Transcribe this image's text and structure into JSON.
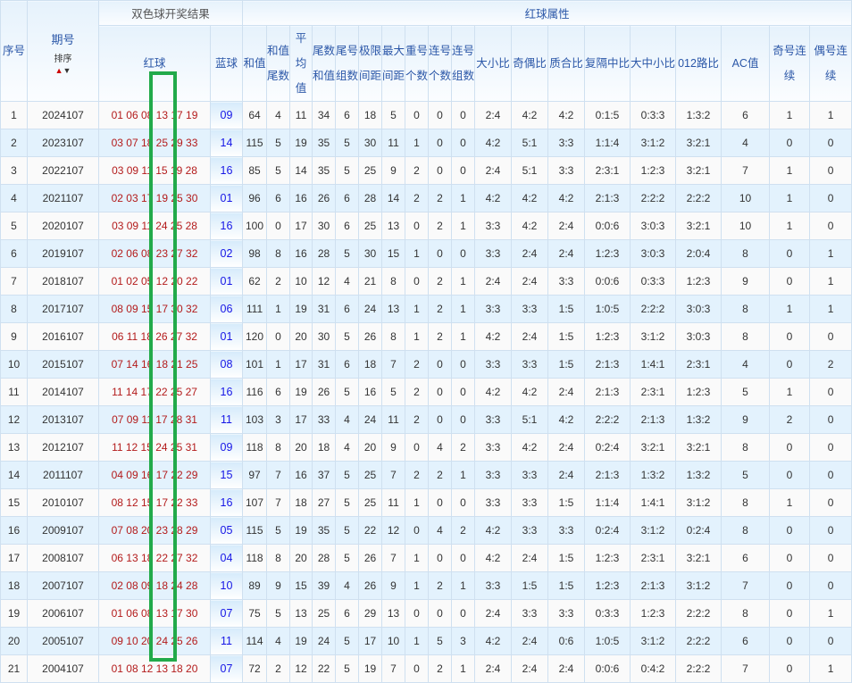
{
  "header": {
    "seq": "序号",
    "issue": "期号",
    "sort_label": "排序",
    "draw_result": "双色球开奖结果",
    "red_ball": "红球",
    "blue_ball": "蓝球",
    "red_attrs": "红球属性",
    "columns": [
      "和值",
      "和值尾数",
      "平均值",
      "尾数和值",
      "尾号组数",
      "极限间距",
      "最大间距",
      "重号个数",
      "连号个数",
      "连号组数",
      "大小比",
      "奇偶比",
      "质合比",
      "复隔中比",
      "大中小比",
      "012路比",
      "AC值",
      "奇号连续",
      "偶号连续"
    ]
  },
  "colors": {
    "red_ball": "#b31b1b",
    "blue_ball": "#1616e6",
    "highlight_box": "#22aa4a",
    "header_text": "#2b57a8"
  },
  "icons": {
    "sort_up": "arrow-up-icon",
    "sort_down": "arrow-down-icon"
  },
  "rows": [
    [
      "1",
      "2024107",
      "01 06 08 13 17 19",
      "09",
      "64",
      "4",
      "11",
      "34",
      "6",
      "18",
      "5",
      "0",
      "0",
      "0",
      "2:4",
      "4:2",
      "4:2",
      "0:1:5",
      "0:3:3",
      "1:3:2",
      "6",
      "1",
      "1"
    ],
    [
      "2",
      "2023107",
      "03 07 18 25 29 33",
      "14",
      "115",
      "5",
      "19",
      "35",
      "5",
      "30",
      "11",
      "1",
      "0",
      "0",
      "4:2",
      "5:1",
      "3:3",
      "1:1:4",
      "3:1:2",
      "3:2:1",
      "4",
      "0",
      "0"
    ],
    [
      "3",
      "2022107",
      "03 09 11 15 19 28",
      "16",
      "85",
      "5",
      "14",
      "35",
      "5",
      "25",
      "9",
      "2",
      "0",
      "0",
      "2:4",
      "5:1",
      "3:3",
      "2:3:1",
      "1:2:3",
      "3:2:1",
      "7",
      "1",
      "0"
    ],
    [
      "4",
      "2021107",
      "02 03 17 19 25 30",
      "01",
      "96",
      "6",
      "16",
      "26",
      "6",
      "28",
      "14",
      "2",
      "2",
      "1",
      "4:2",
      "4:2",
      "4:2",
      "2:1:3",
      "2:2:2",
      "2:2:2",
      "10",
      "1",
      "0"
    ],
    [
      "5",
      "2020107",
      "03 09 11 24 25 28",
      "16",
      "100",
      "0",
      "17",
      "30",
      "6",
      "25",
      "13",
      "0",
      "2",
      "1",
      "3:3",
      "4:2",
      "2:4",
      "0:0:6",
      "3:0:3",
      "3:2:1",
      "10",
      "1",
      "0"
    ],
    [
      "6",
      "2019107",
      "02 06 08 23 27 32",
      "02",
      "98",
      "8",
      "16",
      "28",
      "5",
      "30",
      "15",
      "1",
      "0",
      "0",
      "3:3",
      "2:4",
      "2:4",
      "1:2:3",
      "3:0:3",
      "2:0:4",
      "8",
      "0",
      "1"
    ],
    [
      "7",
      "2018107",
      "01 02 05 12 20 22",
      "01",
      "62",
      "2",
      "10",
      "12",
      "4",
      "21",
      "8",
      "0",
      "2",
      "1",
      "2:4",
      "2:4",
      "3:3",
      "0:0:6",
      "0:3:3",
      "1:2:3",
      "9",
      "0",
      "1"
    ],
    [
      "8",
      "2017107",
      "08 09 15 17 30 32",
      "06",
      "111",
      "1",
      "19",
      "31",
      "6",
      "24",
      "13",
      "1",
      "2",
      "1",
      "3:3",
      "3:3",
      "1:5",
      "1:0:5",
      "2:2:2",
      "3:0:3",
      "8",
      "1",
      "1"
    ],
    [
      "9",
      "2016107",
      "06 11 18 26 27 32",
      "01",
      "120",
      "0",
      "20",
      "30",
      "5",
      "26",
      "8",
      "1",
      "2",
      "1",
      "4:2",
      "2:4",
      "1:5",
      "1:2:3",
      "3:1:2",
      "3:0:3",
      "8",
      "0",
      "0"
    ],
    [
      "10",
      "2015107",
      "07 14 16 18 21 25",
      "08",
      "101",
      "1",
      "17",
      "31",
      "6",
      "18",
      "7",
      "2",
      "0",
      "0",
      "3:3",
      "3:3",
      "1:5",
      "2:1:3",
      "1:4:1",
      "2:3:1",
      "4",
      "0",
      "2"
    ],
    [
      "11",
      "2014107",
      "11 14 17 22 25 27",
      "16",
      "116",
      "6",
      "19",
      "26",
      "5",
      "16",
      "5",
      "2",
      "0",
      "0",
      "4:2",
      "4:2",
      "2:4",
      "2:1:3",
      "2:3:1",
      "1:2:3",
      "5",
      "1",
      "0"
    ],
    [
      "12",
      "2013107",
      "07 09 11 17 28 31",
      "11",
      "103",
      "3",
      "17",
      "33",
      "4",
      "24",
      "11",
      "2",
      "0",
      "0",
      "3:3",
      "5:1",
      "4:2",
      "2:2:2",
      "2:1:3",
      "1:3:2",
      "9",
      "2",
      "0"
    ],
    [
      "13",
      "2012107",
      "11 12 15 24 25 31",
      "09",
      "118",
      "8",
      "20",
      "18",
      "4",
      "20",
      "9",
      "0",
      "4",
      "2",
      "3:3",
      "4:2",
      "2:4",
      "0:2:4",
      "3:2:1",
      "3:2:1",
      "8",
      "0",
      "0"
    ],
    [
      "14",
      "2011107",
      "04 09 16 17 22 29",
      "15",
      "97",
      "7",
      "16",
      "37",
      "5",
      "25",
      "7",
      "2",
      "2",
      "1",
      "3:3",
      "3:3",
      "2:4",
      "2:1:3",
      "1:3:2",
      "1:3:2",
      "5",
      "0",
      "0"
    ],
    [
      "15",
      "2010107",
      "08 12 15 17 22 33",
      "16",
      "107",
      "7",
      "18",
      "27",
      "5",
      "25",
      "11",
      "1",
      "0",
      "0",
      "3:3",
      "3:3",
      "1:5",
      "1:1:4",
      "1:4:1",
      "3:1:2",
      "8",
      "1",
      "0"
    ],
    [
      "16",
      "2009107",
      "07 08 20 23 28 29",
      "05",
      "115",
      "5",
      "19",
      "35",
      "5",
      "22",
      "12",
      "0",
      "4",
      "2",
      "4:2",
      "3:3",
      "3:3",
      "0:2:4",
      "3:1:2",
      "0:2:4",
      "8",
      "0",
      "0"
    ],
    [
      "17",
      "2008107",
      "06 13 18 22 27 32",
      "04",
      "118",
      "8",
      "20",
      "28",
      "5",
      "26",
      "7",
      "1",
      "0",
      "0",
      "4:2",
      "2:4",
      "1:5",
      "1:2:3",
      "2:3:1",
      "3:2:1",
      "6",
      "0",
      "0"
    ],
    [
      "18",
      "2007107",
      "02 08 09 18 24 28",
      "10",
      "89",
      "9",
      "15",
      "39",
      "4",
      "26",
      "9",
      "1",
      "2",
      "1",
      "3:3",
      "1:5",
      "1:5",
      "1:2:3",
      "2:1:3",
      "3:1:2",
      "7",
      "0",
      "0"
    ],
    [
      "19",
      "2006107",
      "01 06 08 13 17 30",
      "07",
      "75",
      "5",
      "13",
      "25",
      "6",
      "29",
      "13",
      "0",
      "0",
      "0",
      "2:4",
      "3:3",
      "3:3",
      "0:3:3",
      "1:2:3",
      "2:2:2",
      "8",
      "0",
      "1"
    ],
    [
      "20",
      "2005107",
      "09 10 20 24 25 26",
      "11",
      "114",
      "4",
      "19",
      "24",
      "5",
      "17",
      "10",
      "1",
      "5",
      "3",
      "4:2",
      "2:4",
      "0:6",
      "1:0:5",
      "3:1:2",
      "2:2:2",
      "6",
      "0",
      "0"
    ],
    [
      "21",
      "2004107",
      "01 08 12 13 18 20",
      "07",
      "72",
      "2",
      "12",
      "22",
      "5",
      "19",
      "7",
      "0",
      "2",
      "1",
      "2:4",
      "2:4",
      "2:4",
      "0:0:6",
      "0:4:2",
      "2:2:2",
      "7",
      "0",
      "1"
    ]
  ]
}
